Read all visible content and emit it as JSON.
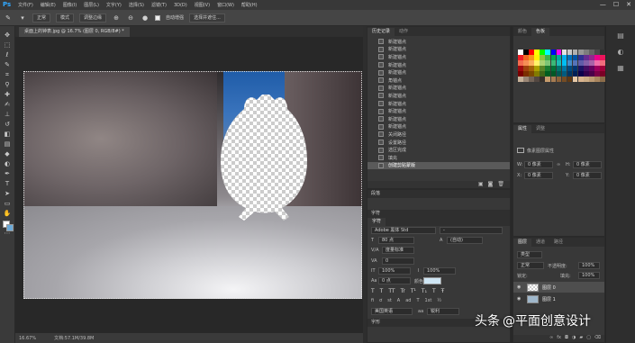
{
  "app": {
    "logo": "Ps",
    "menu": [
      "文件(F)",
      "编辑(E)",
      "图像(I)",
      "图层(L)",
      "文字(Y)",
      "选择(S)",
      "滤镜(T)",
      "3D(D)",
      "视图(V)",
      "窗口(W)",
      "帮助(H)"
    ],
    "window_controls": [
      "—",
      "☐",
      "✕"
    ]
  },
  "options_bar": {
    "mode": "正常",
    "opacity_label": "模式",
    "refine": "调整边缘",
    "auto_enhance": "自动增强",
    "select_subject": "选择并遮住..."
  },
  "document": {
    "tab_title": "桌面上的钟表.jpg @ 16.7% (图层 0, RGB/8#) *",
    "status_zoom": "16.67%",
    "status_doc": "文档:57.1M/39.8M"
  },
  "history": {
    "tabs": [
      "历史记录",
      "动作"
    ],
    "items": [
      "新建锚点",
      "新建锚点",
      "新建锚点",
      "新建锚点",
      "新建锚点",
      "角锚点",
      "新建锚点",
      "新建锚点",
      "新建锚点",
      "新建锚点",
      "新建锚点",
      "新建锚点",
      "关闭路径",
      "设置路径",
      "选区完成",
      "填充",
      "创建剪贴蒙版"
    ],
    "selected_index": 16,
    "footer_icons": [
      "snapshot-icon",
      "camera-icon",
      "trash-icon"
    ]
  },
  "character": {
    "sections": [
      "段落",
      "字符"
    ],
    "sub_tab": "字符",
    "font_family": "Adobe 黑体 Std",
    "font_style": "-",
    "size": "80 点",
    "leading": "(自动)",
    "kerning": "度量标准",
    "tracking": "0",
    "vscale": "100%",
    "hscale": "100%",
    "baseline": "0 点",
    "color_label": "颜色:",
    "color": "#cfe6f4",
    "language": "美国英语",
    "aa": "锐利",
    "text_styles": [
      "T",
      "T",
      "TT",
      "Tr",
      "T¹",
      "T₁",
      "T",
      "Ŧ"
    ],
    "bottom_tab": "字形"
  },
  "swatches": {
    "tabs": [
      "颜色",
      "色板"
    ],
    "colors": [
      "#ffffff",
      "#000000",
      "#ff0000",
      "#ffff00",
      "#00ff00",
      "#00ffff",
      "#0000ff",
      "#ff00ff",
      "#e3e3e3",
      "#c9c9c9",
      "#b0b0b0",
      "#969696",
      "#7d7d7d",
      "#646464",
      "#4a4a4a",
      "#313131",
      "#ee1d24",
      "#f26522",
      "#f7941d",
      "#fff200",
      "#8dc63f",
      "#39b54a",
      "#00a651",
      "#00a99d",
      "#00aeef",
      "#0072bc",
      "#0054a6",
      "#2e3192",
      "#662d91",
      "#92278f",
      "#ec008c",
      "#ed145b",
      "#f26c4f",
      "#f68e55",
      "#fbaf5c",
      "#fff467",
      "#acd372",
      "#7cc576",
      "#3bb878",
      "#1abbb4",
      "#00bff3",
      "#438ccb",
      "#5574b9",
      "#605ca8",
      "#855fa8",
      "#a763a8",
      "#f06ea9",
      "#f26d7d",
      "#9e0b0f",
      "#a0410d",
      "#a36209",
      "#aba000",
      "#598527",
      "#1a7b30",
      "#007236",
      "#00746b",
      "#0076a3",
      "#004b80",
      "#003471",
      "#1b1464",
      "#440e62",
      "#630460",
      "#9e005d",
      "#9e0039",
      "#790000",
      "#7b2e00",
      "#7d4900",
      "#827b00",
      "#406618",
      "#005e20",
      "#005826",
      "#005952",
      "#005b7f",
      "#003663",
      "#002157",
      "#0d004c",
      "#32004b",
      "#4b0049",
      "#7b0046",
      "#7a0026",
      "#c7b299",
      "#998675",
      "#736357",
      "#534741",
      "#37302a",
      "#c69c6d",
      "#a67c52",
      "#8c6239",
      "#754c24",
      "#603913",
      "#e6c9a8",
      "#d9b48f",
      "#ccab85",
      "#bd9a73",
      "#a9865f",
      "#8c6d4a"
    ]
  },
  "properties": {
    "tabs": [
      "属性",
      "调整"
    ],
    "kind": "像素图层属性",
    "w_label": "W:",
    "w_value": "0 像素",
    "h_label": "H:",
    "h_value": "0 像素",
    "x_label": "X:",
    "x_value": "0 像素",
    "y_label": "Y:",
    "y_value": "0 像素"
  },
  "layers": {
    "tabs": [
      "图层",
      "通道",
      "路径"
    ],
    "filter": "类型",
    "blend": "正常",
    "opacity_label": "不透明度:",
    "opacity": "100%",
    "lock_label": "锁定:",
    "fill_label": "填充:",
    "fill": "100%",
    "items": [
      {
        "name": "图层 0",
        "selected": true
      },
      {
        "name": "图层 1",
        "selected": false
      }
    ],
    "footer_icons": [
      "link-icon",
      "fx-icon",
      "mask-icon",
      "adjustment-icon",
      "folder-icon",
      "new-layer-icon",
      "trash-icon"
    ]
  },
  "watermark": {
    "source": "头条",
    "author": "@平面创意设计"
  }
}
